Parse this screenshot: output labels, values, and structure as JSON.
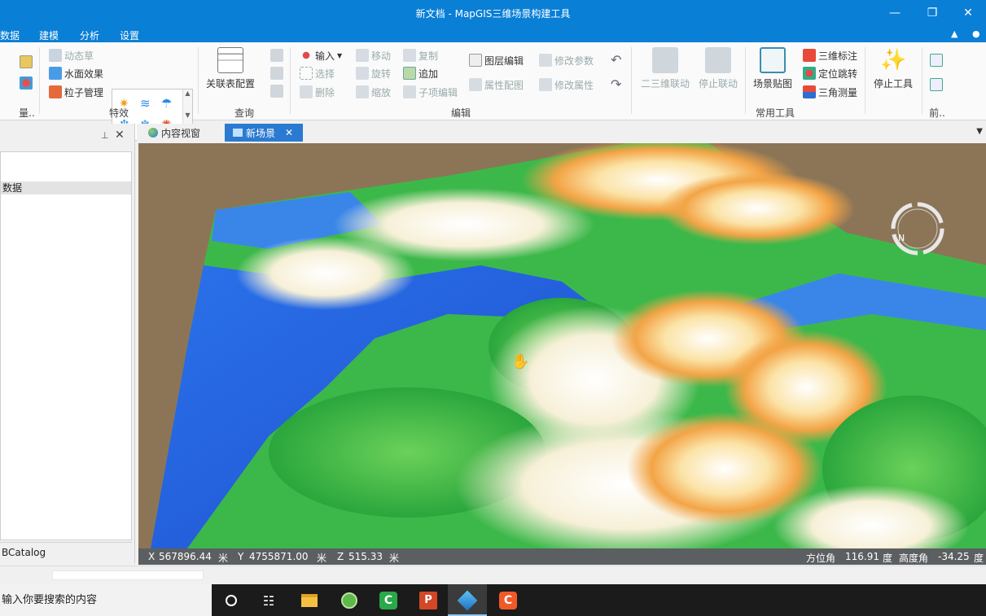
{
  "window": {
    "title": "新文档 - MapGIS三维场景构建工具",
    "controls": {
      "minimize": "—",
      "restore": "❐",
      "close": "✕"
    }
  },
  "menu": {
    "items": [
      "数据",
      "建模",
      "分析",
      "设置"
    ]
  },
  "ribbon": {
    "groups": {
      "data_short": "量..",
      "effects": "特效",
      "query": "查询",
      "edit": "编辑",
      "common": "常用工具",
      "last_short": "前.."
    },
    "effects": {
      "dynamic_grass": "动态草",
      "water_effect": "水面效果",
      "particle_manager": "粒子管理"
    },
    "query": {
      "relation_config": "关联表配置"
    },
    "edit": {
      "input": "输入",
      "select": "选择",
      "delete": "删除",
      "move": "移动",
      "rotate": "旋转",
      "scale": "缩放",
      "copy": "复制",
      "append": "追加",
      "subitem_edit": "子项编辑",
      "layer_edit": "图层编辑",
      "attr_map": "属性配图",
      "modify_params": "修改参数",
      "modify_attr": "修改属性"
    },
    "common": {
      "link_2d3d": "二三维联动",
      "stop_link": "停止联动",
      "scene_map": "场景贴图",
      "label_3d": "三维标注",
      "locate_jump": "定位跳转",
      "triangle_measure": "三角测量",
      "stop_tool": "停止工具"
    }
  },
  "left_panel": {
    "node_label": "数据",
    "bottom_tab": "BCatalog"
  },
  "tabs": [
    {
      "label": "内容视窗",
      "active": false
    },
    {
      "label": "新场景",
      "active": true
    }
  ],
  "status": {
    "x_label": "X",
    "x_value": "567896.44",
    "y_label": "Y",
    "y_value": "4755871.00",
    "z_label": "Z",
    "z_value": "515.33",
    "unit_m": "米",
    "azimuth_label": "方位角",
    "azimuth_value": "116.91",
    "elevation_label": "高度角",
    "elevation_value": "-34.25",
    "unit_deg": "度"
  },
  "taskbar": {
    "search_placeholder": "输入你要搜索的内容"
  },
  "colors": {
    "titlebar": "#0a7fd6",
    "tab_active": "#2b7ad1",
    "terrain_low": "#1f5fe0",
    "terrain_mid": "#39b54a",
    "terrain_high": "#f2a33a",
    "terrain_peak": "#ffffff",
    "ground": "#8c7557"
  }
}
